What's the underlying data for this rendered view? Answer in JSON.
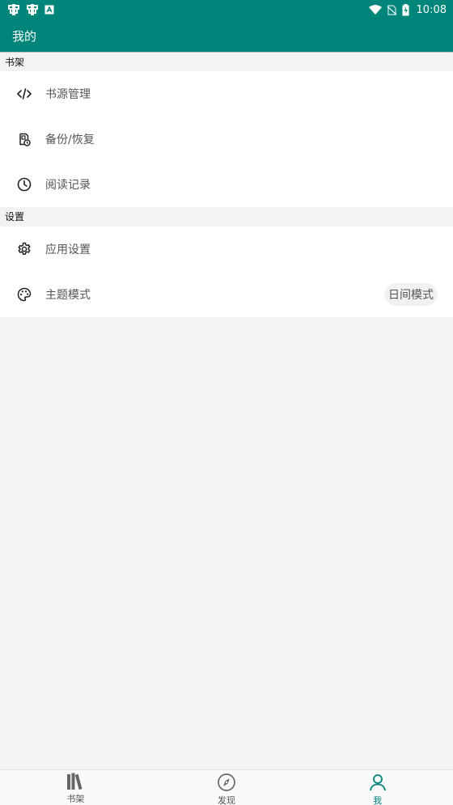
{
  "status_bar": {
    "time": "10:08",
    "icons": [
      "notification-icon",
      "notification-icon",
      "app-badge-icon",
      "wifi-icon",
      "no-sim-icon",
      "battery-charging-icon"
    ]
  },
  "app_bar": {
    "title": "我的"
  },
  "sections": [
    {
      "header": "书架",
      "items": [
        {
          "label": "书源管理",
          "icon": "code-icon"
        },
        {
          "label": "备份/恢复",
          "icon": "backup-icon"
        },
        {
          "label": "阅读记录",
          "icon": "clock-icon"
        }
      ]
    },
    {
      "header": "设置",
      "items": [
        {
          "label": "应用设置",
          "icon": "gear-icon"
        },
        {
          "label": "主题模式",
          "icon": "palette-icon",
          "value": "日间模式"
        }
      ]
    }
  ],
  "bottom_nav": {
    "items": [
      {
        "label": "书架",
        "icon": "bookshelf-icon"
      },
      {
        "label": "发现",
        "icon": "compass-icon"
      },
      {
        "label": "我",
        "icon": "person-icon",
        "active": true
      }
    ]
  },
  "colors": {
    "accent": "#00857a",
    "background": "#f3f3f3"
  }
}
